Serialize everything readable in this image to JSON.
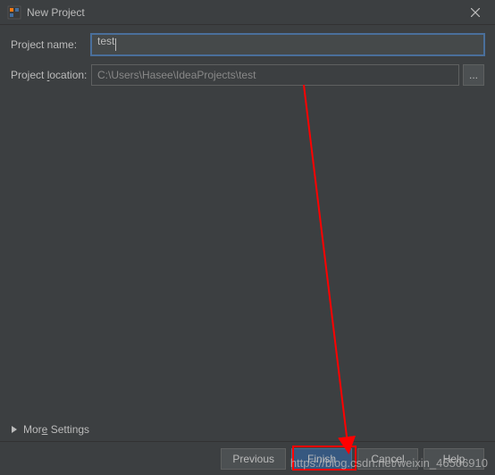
{
  "titlebar": {
    "title": "New Project",
    "close_icon": "close"
  },
  "form": {
    "name_label": "Project name:",
    "name_value": "test",
    "location_label": "Project location:",
    "location_value": "C:\\Users\\Hasee\\IdeaProjects\\test",
    "browse_label": "..."
  },
  "more_settings": {
    "label": "More Settings"
  },
  "buttons": {
    "previous": "Previous",
    "finish": "Finish",
    "cancel": "Cancel",
    "help": "Help"
  },
  "watermark": "https://blog.csdn.net/weixin_46506910"
}
